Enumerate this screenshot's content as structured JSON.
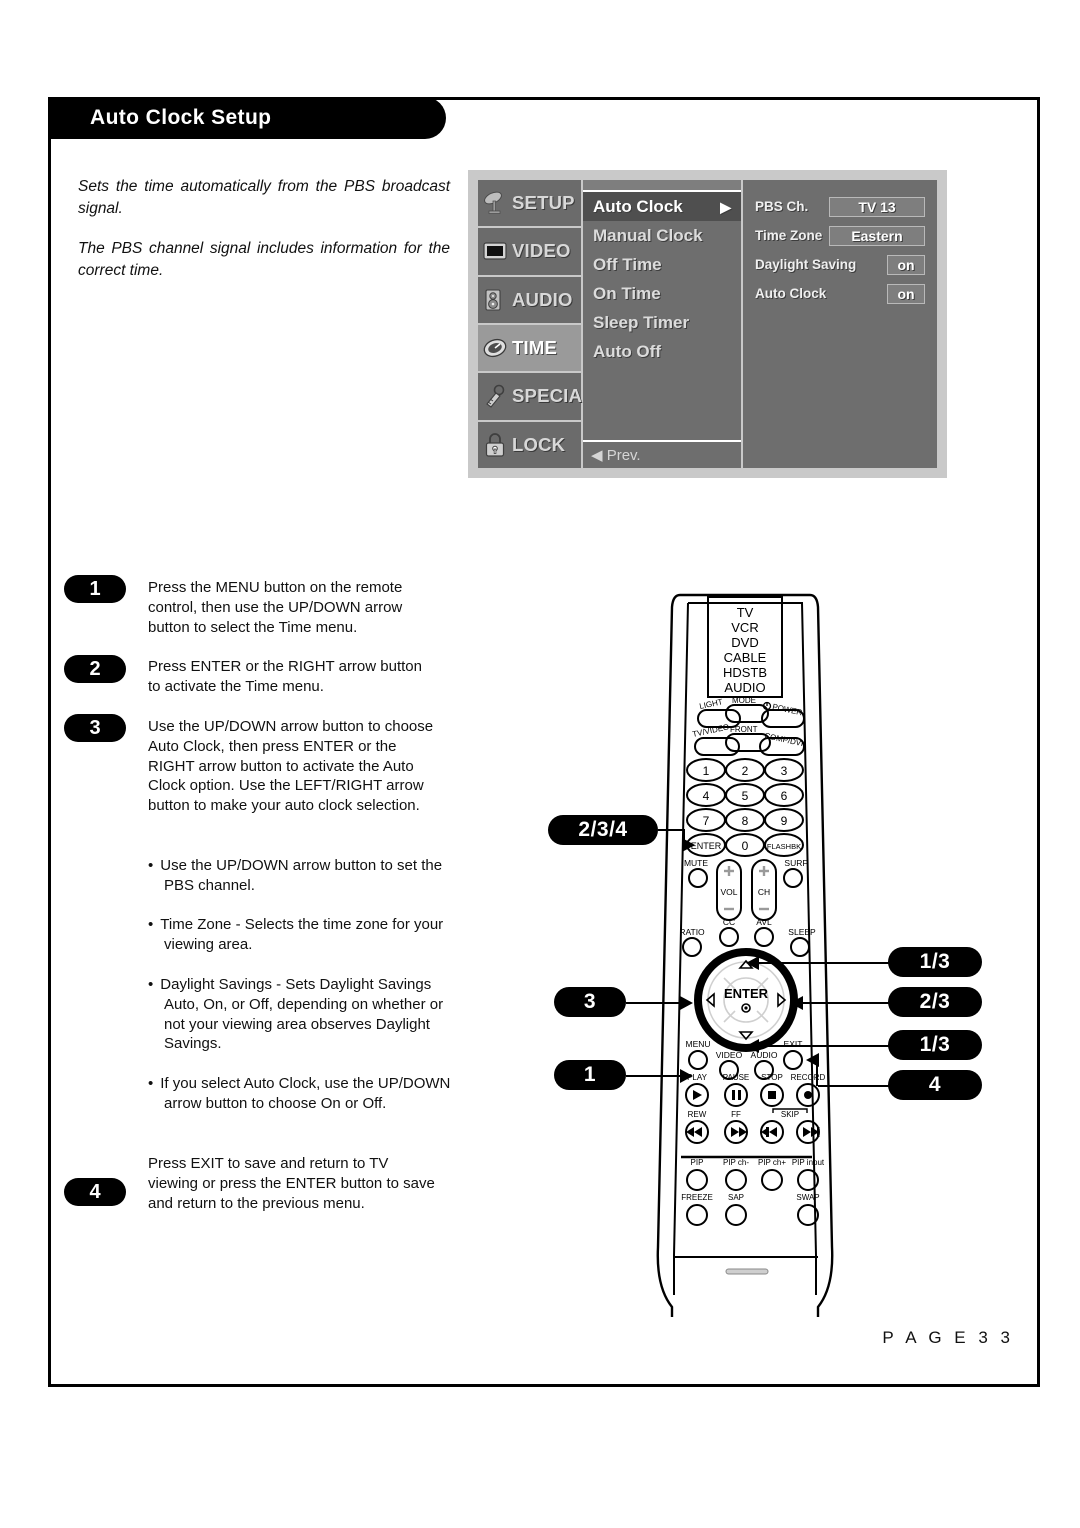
{
  "page": {
    "title": "Auto Clock Setup",
    "page_number": "P A G E   3 3"
  },
  "intro": {
    "paragraph_1": "Sets the time automatically from the PBS broadcast signal.",
    "paragraph_2": "The PBS channel signal includes information for the correct time."
  },
  "osd": {
    "categories": [
      {
        "label": "SETUP",
        "icon": "satellite-dish-icon",
        "active": false
      },
      {
        "label": "VIDEO",
        "icon": "tv-screen-icon",
        "active": false
      },
      {
        "label": "AUDIO",
        "icon": "speaker-icon",
        "active": false
      },
      {
        "label": "TIME",
        "icon": "clock-icon",
        "active": true
      },
      {
        "label": "SPECIAL",
        "icon": "key-icon",
        "active": false
      },
      {
        "label": "LOCK",
        "icon": "padlock-icon",
        "active": false
      }
    ],
    "menu_items": [
      {
        "label": "Auto Clock",
        "selected": true,
        "arrow": "▶"
      },
      {
        "label": "Manual Clock",
        "selected": false,
        "arrow": ""
      },
      {
        "label": "Off Time",
        "selected": false,
        "arrow": ""
      },
      {
        "label": "On Time",
        "selected": false,
        "arrow": ""
      },
      {
        "label": "Sleep Timer",
        "selected": false,
        "arrow": ""
      },
      {
        "label": "Auto Off",
        "selected": false,
        "arrow": ""
      }
    ],
    "prev_label": "◀ Prev.",
    "settings": [
      {
        "label": "PBS Ch.",
        "value": "TV  13",
        "width": "wide"
      },
      {
        "label": "Time Zone",
        "value": "Eastern",
        "width": "wide"
      },
      {
        "label": "Daylight Saving",
        "value": "on",
        "width": "narrow"
      },
      {
        "label": "Auto Clock",
        "value": "on",
        "width": "narrow"
      }
    ],
    "colors": {
      "panel_bg": "#c9c9c9",
      "menu_bg": "#6e6e6e",
      "selected_row": "#4f4f4f",
      "active_category": "#9a9a9a"
    }
  },
  "steps": [
    {
      "number": "1",
      "text": "Press the MENU button on the remote control, then use the UP/DOWN arrow button to select the Time menu."
    },
    {
      "number": "2",
      "text": "Press ENTER or the RIGHT arrow button to activate the Time menu."
    },
    {
      "number": "3",
      "text": "Use the UP/DOWN arrow button to choose Auto Clock, then press ENTER or the RIGHT arrow button to activate the Auto Clock option. Use the LEFT/RIGHT arrow button to make your auto clock selection."
    },
    {
      "number": "4",
      "text": "Press EXIT to save and return to TV viewing or press the ENTER button to save and return to the previous menu."
    }
  ],
  "bullets": [
    "Use the UP/DOWN arrow button to set the PBS channel.",
    "Time Zone - Selects the time zone for your viewing area.",
    "Daylight Savings - Sets Daylight Savings Auto, On, or Off, depending on whether or not your viewing area observes Daylight Savings.",
    "If you select Auto Clock, use the UP/DOWN arrow button to choose On or Off."
  ],
  "remote": {
    "device_modes": [
      "TV",
      "VCR",
      "DVD",
      "CABLE",
      "HDSTB",
      "AUDIO"
    ],
    "top_buttons": [
      "LIGHT",
      "MODE",
      "POWER",
      "TV/VIDEO",
      "FRONT",
      "COMP/DVI"
    ],
    "keypad": [
      "1",
      "2",
      "3",
      "4",
      "5",
      "6",
      "7",
      "8",
      "9",
      "ENTER",
      "0",
      "FLASHBK"
    ],
    "volume_row": [
      "MUTE",
      "VOL",
      "CH",
      "SURF"
    ],
    "feature_row": [
      "RATIO",
      "CC",
      "AVL",
      "SLEEP"
    ],
    "nav_center": "ENTER",
    "nav_bottom": [
      "MENU",
      "VIDEO",
      "AUDIO",
      "EXIT"
    ],
    "transport_row_1": [
      "PLAY",
      "PAUSE",
      "STOP",
      "RECORD"
    ],
    "transport_row_2": [
      "REW",
      "FF",
      "SKIP"
    ],
    "pip_row_1": [
      "PIP",
      "PIP ch-",
      "PIP ch+",
      "PIP input"
    ],
    "pip_row_2": [
      "FREEZE",
      "SAP",
      "SWAP"
    ],
    "callouts": [
      {
        "id": "enter-key",
        "label": "2/3/4"
      },
      {
        "id": "up-arrow",
        "label": "1/3"
      },
      {
        "id": "right-arrow",
        "label": "2/3"
      },
      {
        "id": "down-arrow",
        "label": "1/3"
      },
      {
        "id": "left-arrow",
        "label": "3"
      },
      {
        "id": "menu-button",
        "label": "1"
      },
      {
        "id": "exit-button",
        "label": "4"
      }
    ]
  }
}
